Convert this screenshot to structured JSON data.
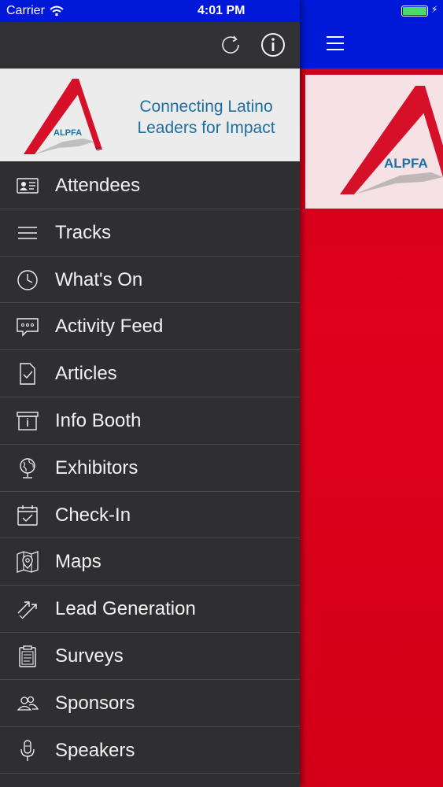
{
  "status_bar": {
    "carrier": "Carrier",
    "time": "4:01 PM",
    "battery_color": "#4cd964"
  },
  "drawer": {
    "toolbar": {
      "refresh_icon": "refresh-icon",
      "info_icon": "info-icon"
    },
    "banner": {
      "logo_text": "ALPFA",
      "tagline_line1": "Connecting Latino",
      "tagline_line2": "Leaders for Impact",
      "tagline_color": "#1c6fa3"
    },
    "menu": [
      {
        "label": "Attendees",
        "icon": "id-card-icon"
      },
      {
        "label": "Tracks",
        "icon": "list-icon"
      },
      {
        "label": "What's On",
        "icon": "clock-icon"
      },
      {
        "label": "Activity Feed",
        "icon": "chat-bubble-icon"
      },
      {
        "label": "Articles",
        "icon": "document-check-icon"
      },
      {
        "label": "Info Booth",
        "icon": "info-booth-icon"
      },
      {
        "label": "Exhibitors",
        "icon": "globe-icon"
      },
      {
        "label": "Check-In",
        "icon": "calendar-check-icon"
      },
      {
        "label": "Maps",
        "icon": "map-pin-icon"
      },
      {
        "label": "Lead Generation",
        "icon": "arrows-icon"
      },
      {
        "label": "Surveys",
        "icon": "clipboard-icon"
      },
      {
        "label": "Sponsors",
        "icon": "people-icon"
      },
      {
        "label": "Speakers",
        "icon": "microphone-icon"
      }
    ]
  },
  "content": {
    "nav_color": "#0018d8",
    "background_color": "#e0001d",
    "banner_logo_text": "ALPFA"
  }
}
